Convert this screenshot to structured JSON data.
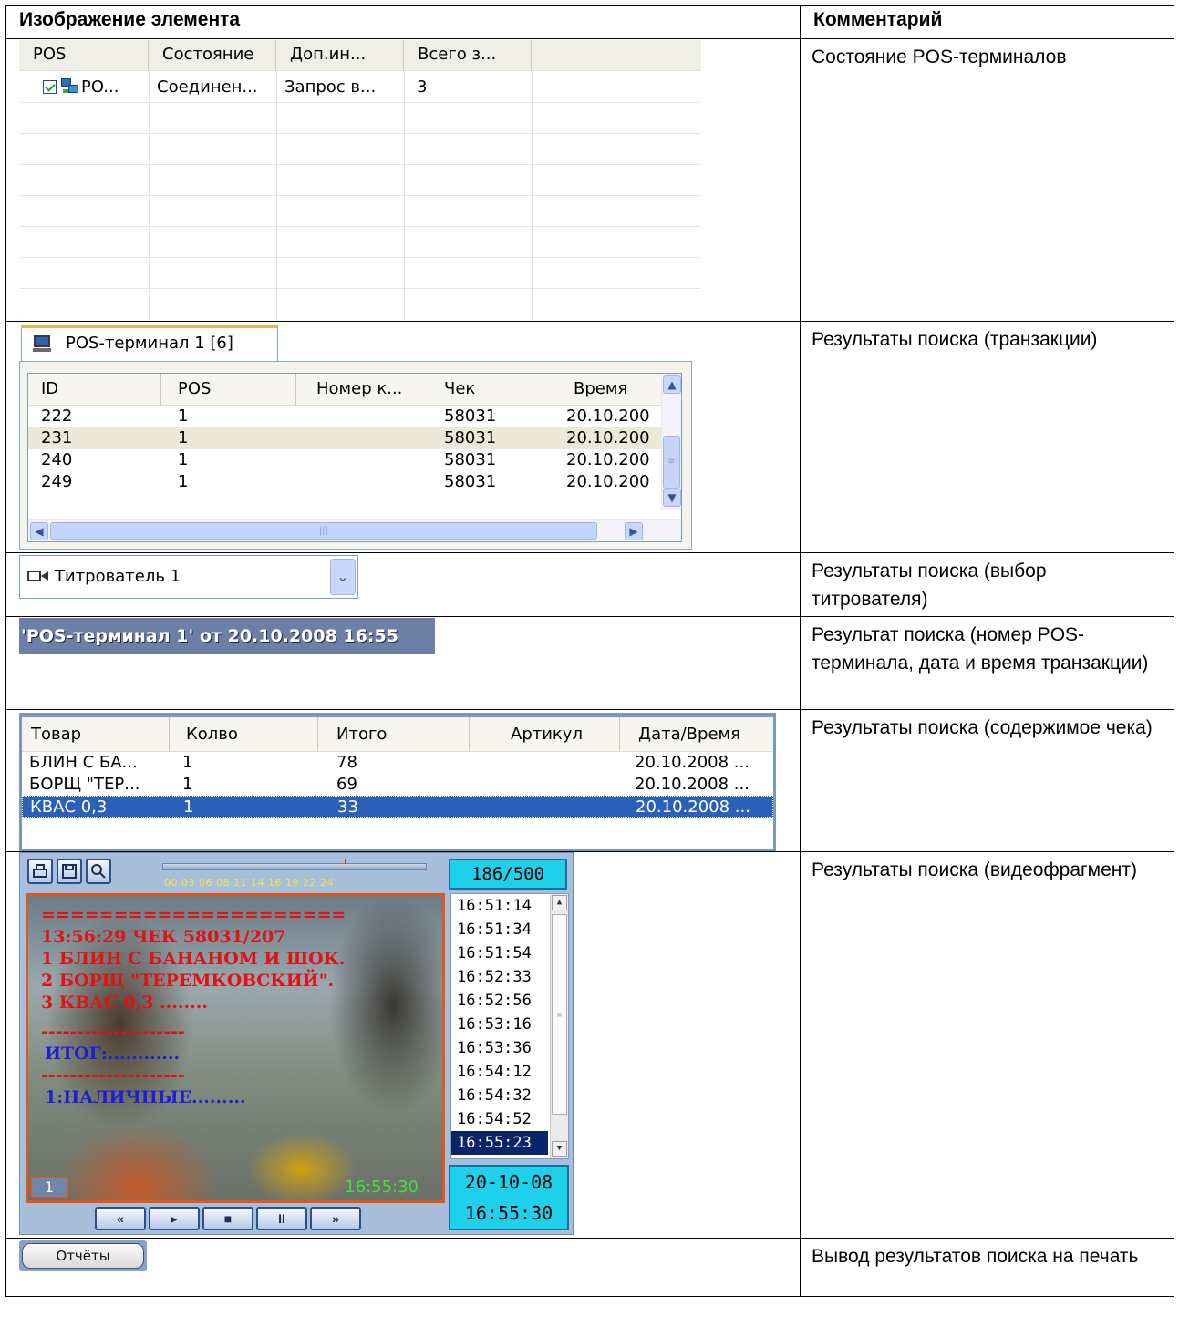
{
  "header": {
    "col1": "Изображение элемента",
    "col2": "Комментарий"
  },
  "comments": [
    "Состояние POS-терминалов",
    "Результаты поиска (транзакции)",
    "Результаты поиска  (выбор титрователя)",
    "Результат поиска (номер POS-терминала, дата и время транзакции)",
    "Результаты поиска (содержимое чека)",
    "Результаты поиска (видеофрагмент)",
    "Вывод результатов поиска на печать"
  ],
  "pos_status": {
    "columns": [
      "POS",
      "Состояние",
      "Доп.ин...",
      "Всего з..."
    ],
    "row": {
      "checked": true,
      "pos": "PO...",
      "state": "Соединен...",
      "info": "Запрос в...",
      "total": "3"
    }
  },
  "transactions": {
    "tab_label": "POS-терминал 1 [6]",
    "columns": [
      "ID",
      "POS",
      "Номер к...",
      "Чек",
      "Время"
    ],
    "rows": [
      {
        "id": "222",
        "pos": "1",
        "num": "",
        "check": "58031",
        "time": "20.10.200"
      },
      {
        "id": "231",
        "pos": "1",
        "num": "",
        "check": "58031",
        "time": "20.10.200"
      },
      {
        "id": "240",
        "pos": "1",
        "num": "",
        "check": "58031",
        "time": "20.10.200"
      },
      {
        "id": "249",
        "pos": "1",
        "num": "",
        "check": "58031",
        "time": "20.10.200"
      }
    ],
    "selected_row": 1
  },
  "titler": {
    "selected": "Титрователь 1"
  },
  "result_banner": "'POS-терминал 1' от 20.10.2008 16:55",
  "receipt": {
    "columns": [
      "Товар",
      "Колво",
      "Итого",
      "Артикул",
      "Дата/Время"
    ],
    "rows": [
      {
        "item": "БЛИН С БА...",
        "qty": "1",
        "total": "78",
        "sku": "",
        "dt": "20.10.2008 ..."
      },
      {
        "item": "БОРЩ \"ТЕР...",
        "qty": "1",
        "total": "69",
        "sku": "",
        "dt": "20.10.2008 ..."
      },
      {
        "item": "КВАС 0,3",
        "qty": "1",
        "total": "33",
        "sku": "",
        "dt": "20.10.2008 ..."
      }
    ],
    "selected_row": 2
  },
  "player": {
    "counter": "186/500",
    "timeline_ticks": "00  03  06 08  11   14  16   19   22 24",
    "overlay_lines": [
      "=====================",
      "13:56:29  ЧЕК 58031/207",
      "1 БЛИН С БАНАНОМ И ШОК.",
      "2 БОРЩ \"ТЕРЕМКОВСКИЙ\".",
      "3 КВАС 0,3 ........",
      "--------------------",
      "ИТОГ:............",
      "--------------------",
      "1:НАЛИЧНЫЕ........."
    ],
    "camera_number": "1",
    "timestamp": "16:55:30",
    "times": [
      "16:51:14",
      "16:51:34",
      "16:51:54",
      "16:52:33",
      "16:52:56",
      "16:53:16",
      "16:53:36",
      "16:54:12",
      "16:54:32",
      "16:54:52",
      "16:55:23"
    ],
    "selected_time_index": 10,
    "date": "20-10-08",
    "time": "16:55:30",
    "controls": [
      "«",
      "▸",
      "■",
      "II",
      "»"
    ]
  },
  "reports_button": "Отчёты"
}
